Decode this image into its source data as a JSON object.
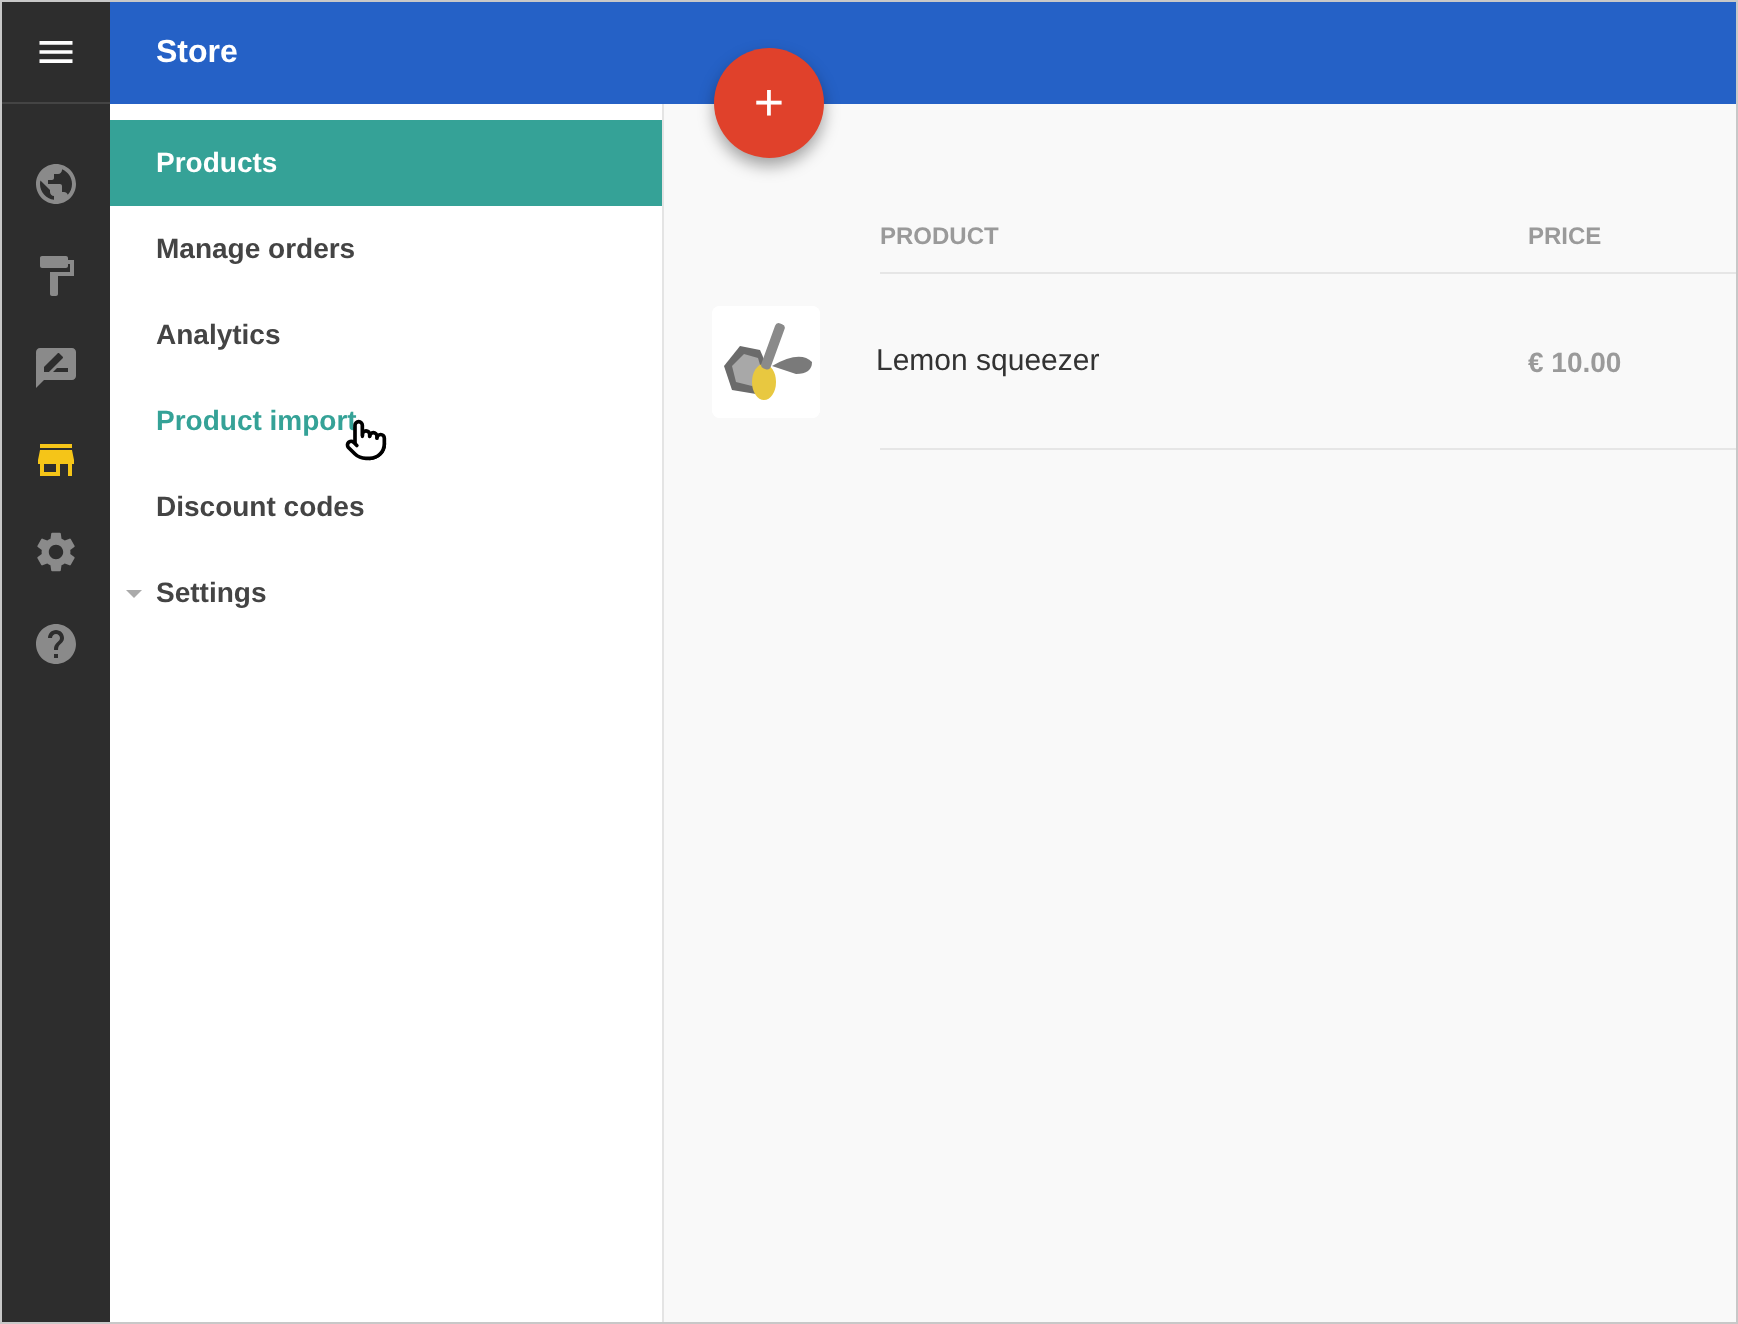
{
  "header": {
    "title": "Store"
  },
  "rail": [
    {
      "selected": false
    },
    {
      "selected": false
    },
    {
      "selected": false
    },
    {
      "selected": true
    },
    {
      "selected": false
    },
    {
      "selected": false
    }
  ],
  "menu": [
    {
      "label": "Products",
      "selected": true,
      "hovered": false
    },
    {
      "label": "Manage orders",
      "selected": false,
      "hovered": false
    },
    {
      "label": "Analytics",
      "selected": false,
      "hovered": false
    },
    {
      "label": "Product import",
      "selected": false,
      "hovered": true
    },
    {
      "label": "Discount codes",
      "selected": false,
      "hovered": false
    },
    {
      "label": "Settings",
      "selected": false,
      "hovered": false,
      "expanded": true
    }
  ],
  "add_button": {
    "label": "+"
  },
  "table": {
    "columns": [
      "PRODUCT",
      "PRICE"
    ],
    "rows": [
      {
        "product": "Lemon squeezer",
        "price": "€ 10.00"
      }
    ]
  }
}
